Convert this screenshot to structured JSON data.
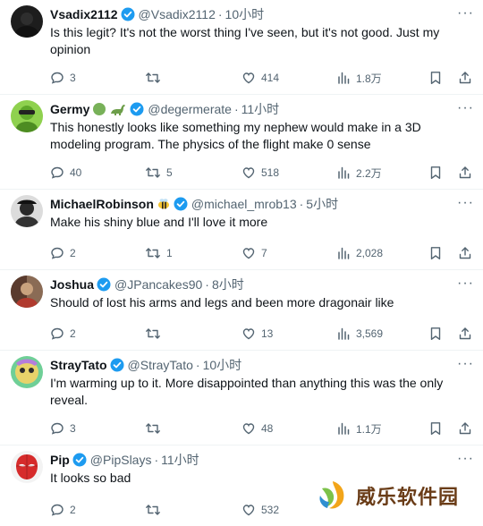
{
  "tweets": [
    {
      "name": "Vsadix2112",
      "handle": "@Vsadix2112",
      "time": "10小时",
      "text": "Is this legit? It's not the worst thing I've seen, but it's not good. Just my opinion",
      "replies": "3",
      "retweets": "",
      "likes": "414",
      "views": "1.8万",
      "avatar_color": "#1d1d1d"
    },
    {
      "name": "Germy",
      "handle": "@degermerate",
      "time": "11小时",
      "text": "This honestly looks like something my nephew would make in a 3D modeling program. The physics of the flight make 0 sense",
      "replies": "40",
      "retweets": "5",
      "likes": "518",
      "views": "2.2万",
      "avatar_color": "#7ecb2e"
    },
    {
      "name": "MichaelRobinson",
      "handle": "@michael_mrob13",
      "time": "5小时",
      "text": "Make his shiny blue and I'll love it more",
      "replies": "2",
      "retweets": "1",
      "likes": "7",
      "views": "2,028",
      "avatar_color": "#3a3a3a"
    },
    {
      "name": "Joshua",
      "handle": "@JPancakes90",
      "time": "8小时",
      "text": "Should of lost his arms and legs and been more dragonair like",
      "replies": "2",
      "retweets": "",
      "likes": "13",
      "views": "3,569",
      "avatar_color": "#6b4a3a"
    },
    {
      "name": "StrayTato",
      "handle": "@StrayTato",
      "time": "10小时",
      "text": "I'm warming up to it. More disappointed than anything this was the only reveal.",
      "replies": "3",
      "retweets": "",
      "likes": "48",
      "views": "1.1万",
      "avatar_color": "#c9b94a"
    },
    {
      "name": "Pip",
      "handle": "@PipSlays",
      "time": "11小时",
      "text": "It looks so bad",
      "replies": "2",
      "retweets": "",
      "likes": "532",
      "views": "",
      "avatar_color": "#d62b2b"
    }
  ],
  "watermark": {
    "text": "威乐软件园"
  },
  "colors": {
    "verified": "#1d9bf0",
    "secondary_text": "#536471",
    "divider": "#eff3f4"
  }
}
